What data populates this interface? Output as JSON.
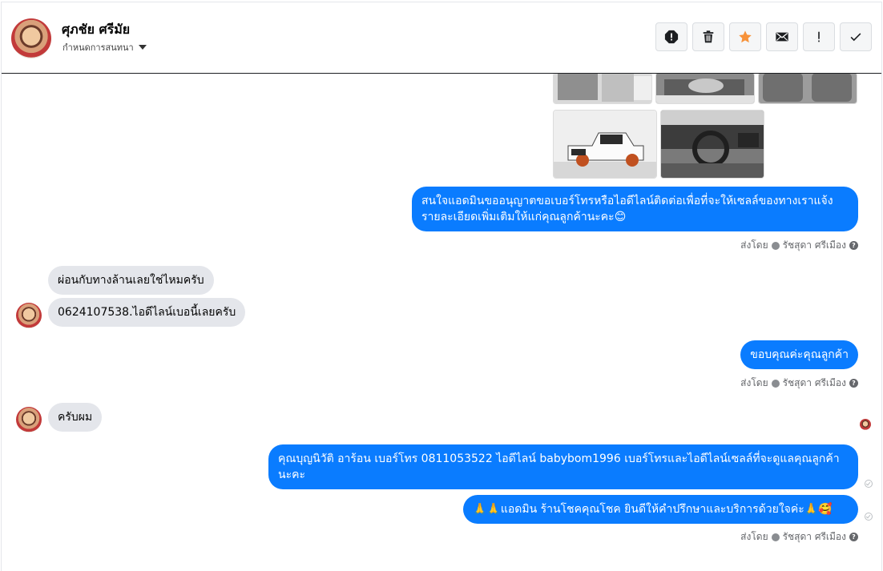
{
  "header": {
    "contact_name": "ศุภชัย ศรีมัย",
    "conversation_settings": "กำหนดการสนทนา"
  },
  "toolbar": {
    "buttons": [
      "report-icon",
      "trash-icon",
      "star-icon",
      "envelope-icon",
      "exclamation-icon",
      "check-icon"
    ],
    "star_color": "#f7923a"
  },
  "colors": {
    "outgoing_bubble": "#0a7cff",
    "incoming_bubble": "#e4e6eb"
  },
  "messages": {
    "m1": "สนใจแอดมินขออนุญาตขอเบอร์โทรหรือไอดีไลน์ติดต่อเพื่อที่จะให้เซลล์ของทางเราแจ้งรายละเอียดเพิ่มเติมให้แก่คุณลูกค้านะคะ😊",
    "m2": "ผ่อนกับทางล้านเลยใช่ไหมครับ",
    "m3": "0624107538.ไอดีไลน์เบอนี้เลยครับ",
    "m4": "ขอบคุณค่ะคุณลูกค้า",
    "m5": "ครับผม",
    "m6": "คุณบุญนิวัติ  อาร้อน        เบอร์โทร 0811053522  ไอดีไลน์ babybom1996   เบอร์โทรและไอดีไลน์เซลล์ที่จะดูแลคุณลูกค้านะคะ",
    "m7": "🙏🙏แอดมิน ร้านโชคคุณโชค ยินดีให้คำปรึกษาและบริการด้วยใจค่ะ🙏🥰"
  },
  "sent_by": {
    "label": "ส่งโดย",
    "agent": "รัชสุดา ศรีเมือง"
  }
}
